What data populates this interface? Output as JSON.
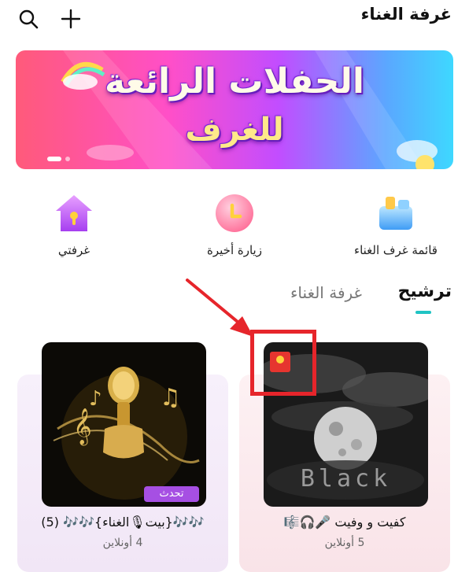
{
  "header": {
    "title": "غرفة الغناء",
    "icons": [
      "search-icon",
      "plus-icon"
    ]
  },
  "banner": {
    "line1": "الحفلات الرائعة",
    "line2": "للغرف"
  },
  "shortcuts": [
    {
      "label": "قائمة غرف الغناء",
      "icon": "building-icon"
    },
    {
      "label": "زيارة أخيرة",
      "icon": "clock-icon"
    },
    {
      "label": "غرفتي",
      "icon": "home-icon"
    }
  ],
  "tabs": {
    "active": "ترشيح",
    "inactive": "غرفة الغناء"
  },
  "rooms": [
    {
      "name": "كفيت و وفيت 🎤🎧🎼",
      "online": "5 أونلاين",
      "thumb_text": "Black",
      "badge": ""
    },
    {
      "name": "🎶🎶{بيت🎙الغناء}🎶🎶 (5)",
      "online": "4 أونلاين",
      "badge": "تحدث"
    }
  ],
  "colors": {
    "accent_teal": "#20c4c4",
    "annotation_red": "#e6252b",
    "badge_purple": "#a64fe3"
  }
}
